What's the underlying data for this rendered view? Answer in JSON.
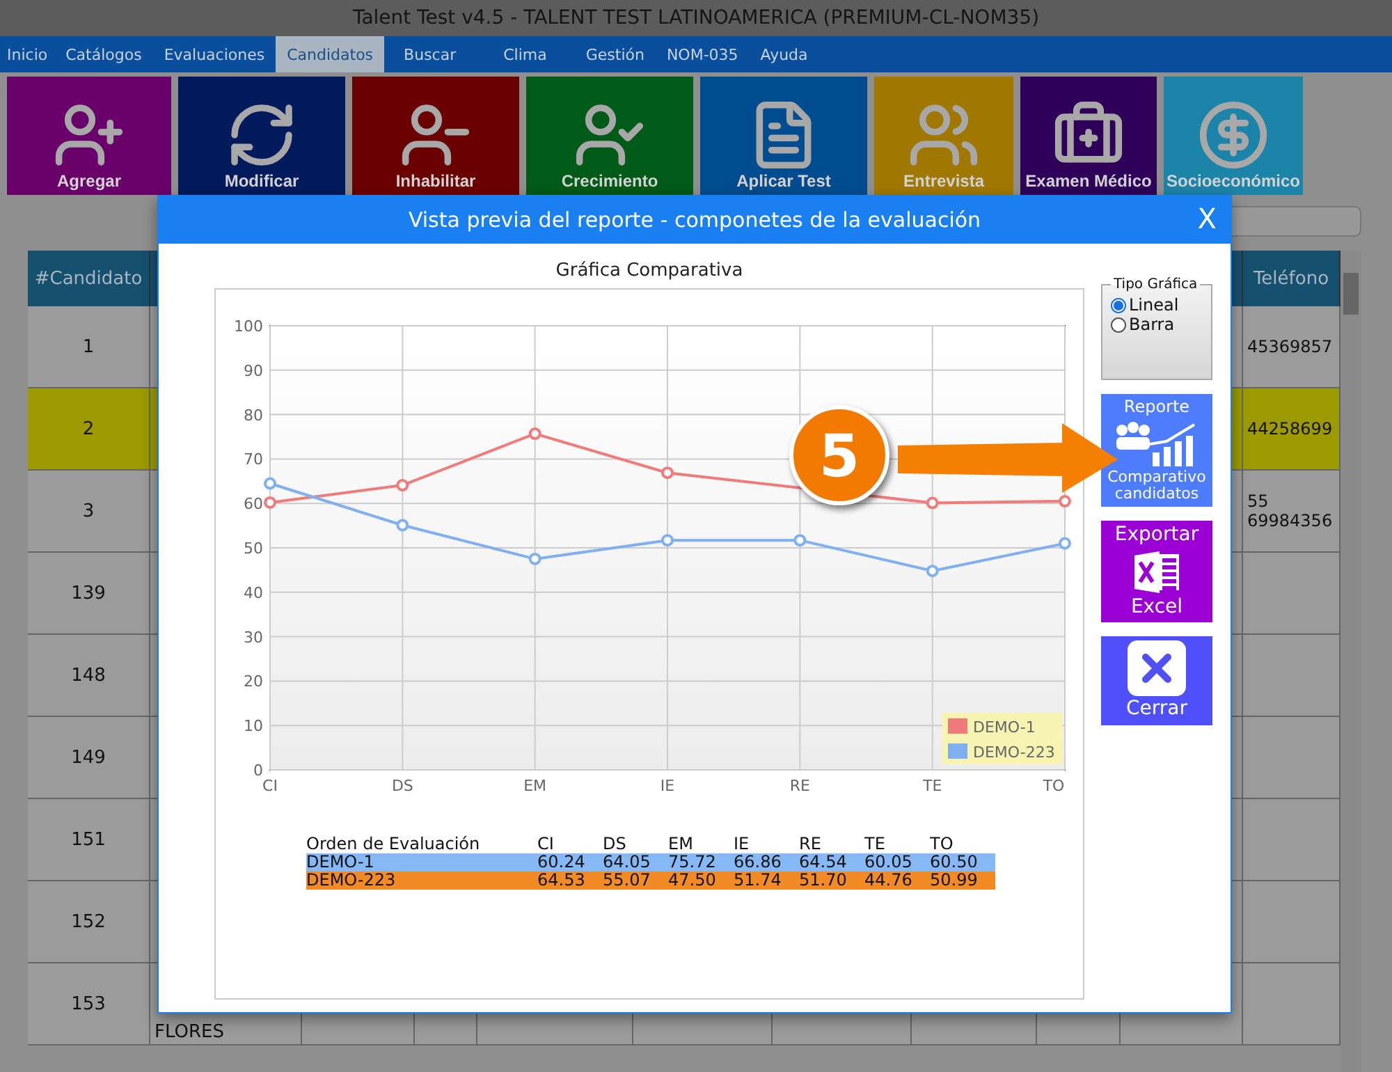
{
  "window": {
    "title": "Talent Test v4.5 - TALENT TEST LATINOAMERICA (PREMIUM-CL-NOM35)"
  },
  "menu": [
    {
      "label": "Inicio",
      "selected": false
    },
    {
      "label": "Catálogos",
      "selected": false
    },
    {
      "label": "Evaluaciones",
      "selected": false
    },
    {
      "label": "Candidatos",
      "selected": true
    },
    {
      "label": "Buscar",
      "selected": false
    },
    {
      "label": "Clima",
      "selected": false
    },
    {
      "label": "Gestión",
      "selected": false
    },
    {
      "label": "NOM-035",
      "selected": false
    },
    {
      "label": "Ayuda",
      "selected": false
    }
  ],
  "toolbar": [
    {
      "label": "Agregar",
      "kind": "add",
      "color": "#6a006a"
    },
    {
      "label": "Modificar",
      "kind": "swap",
      "color": "#001a5c"
    },
    {
      "label": "Inhabilitar",
      "kind": "remove",
      "color": "#6b0000"
    },
    {
      "label": "Crecimiento",
      "kind": "check",
      "color": "#005a18"
    },
    {
      "label": "Aplicar Test",
      "kind": "test",
      "color": "#004c8e"
    },
    {
      "label": "Entrevista",
      "kind": "talk",
      "color": "#a07800"
    },
    {
      "label": "Examen Médico",
      "kind": "medical",
      "color": "#2e005a"
    },
    {
      "label": "Socioeconómico",
      "kind": "money",
      "color": "#1c84a8"
    }
  ],
  "table": {
    "columns": [
      "#Candidato",
      "Teléfono"
    ],
    "rows": [
      {
        "number": "1",
        "phone": "45369857",
        "selected": false
      },
      {
        "number": "2",
        "phone": "44258699",
        "selected": true
      },
      {
        "number": "3",
        "phone": "55 69984356",
        "selected": false
      },
      {
        "number": "139",
        "selected": false
      },
      {
        "number": "148",
        "selected": false
      },
      {
        "number": "149",
        "selected": false
      },
      {
        "number": "151",
        "selected": false
      },
      {
        "number": "152",
        "selected": false
      },
      {
        "number": "153",
        "name": "FLORES",
        "selected": false
      }
    ]
  },
  "dialog": {
    "title": "Vista previa del reporte - componetes de la evaluación",
    "close": "X",
    "chart_data": {
      "type": "line",
      "title": "Gráfica Comparativa",
      "categories": [
        "CI",
        "DS",
        "EM",
        "IE",
        "RE",
        "TE",
        "TO"
      ],
      "series": [
        {
          "name": "DEMO-1",
          "color": "#f07b7b",
          "marker": "circle",
          "values": [
            60.2,
            64.1,
            75.7,
            66.9,
            null,
            60.1,
            60.5
          ]
        },
        {
          "name": "DEMO-223",
          "color": "#7fb0f0",
          "marker": "circle",
          "values": [
            64.5,
            55.1,
            47.5,
            51.7,
            51.7,
            44.8,
            51.0
          ]
        }
      ],
      "grid": true,
      "legend": true,
      "ylim": [
        0,
        100
      ],
      "yticks": [
        0,
        10,
        20,
        30,
        40,
        50,
        60,
        70,
        80,
        90,
        100
      ]
    },
    "data_table": {
      "columns": [
        "Orden de Evaluación",
        "CI",
        "DS",
        "EM",
        "IE",
        "RE",
        "TE",
        "TO"
      ],
      "rows": [
        {
          "label": "DEMO-1",
          "color": "#86b8f6",
          "values": [
            "60.24",
            "64.05",
            "75.72",
            "66.86",
            "64.54",
            "60.05",
            "60.50"
          ]
        },
        {
          "label": "DEMO-223",
          "color": "#f28a26",
          "values": [
            "64.53",
            "55.07",
            "47.50",
            "51.74",
            "51.70",
            "44.76",
            "50.99"
          ]
        }
      ]
    },
    "chart_type": {
      "legend": "Tipo Gráfica",
      "options": [
        {
          "label": "Lineal",
          "selected": true
        },
        {
          "label": "Barra",
          "selected": false
        }
      ]
    },
    "actions": [
      {
        "kind": "report",
        "lines": [
          "Reporte",
          "Comparativo candidatos"
        ]
      },
      {
        "kind": "excel",
        "lines": [
          "Exportar",
          "Excel"
        ]
      },
      {
        "kind": "close",
        "lines": [
          "Cerrar"
        ]
      }
    ]
  },
  "annotation": {
    "label": "5"
  }
}
